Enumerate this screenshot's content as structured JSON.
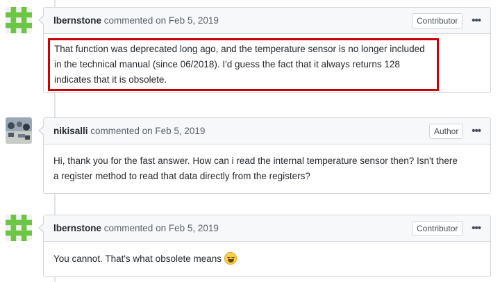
{
  "comments": [
    {
      "author": "lbernstone",
      "meta": "commented on Feb 5, 2019",
      "badge": "Contributor",
      "more": "•••",
      "body": "That function was deprecated long ago, and the temperature sensor is no longer included in the technical manual (since 06/2018). I'd guess the fact that it always returns 128 indicates that it is obsolete."
    },
    {
      "author": "nikisalli",
      "meta": "commented on Feb 5, 2019",
      "badge": "Author",
      "more": "•••",
      "body": "Hi, thank you for the fast answer. How can i read the internal temperature sensor then? Isn't there a register method to read that data directly from the registers?"
    },
    {
      "author": "lbernstone",
      "meta": "commented on Feb 5, 2019",
      "badge": "Contributor",
      "more": "•••",
      "body": "You cannot. That's what obsolete means"
    }
  ],
  "colors": {
    "highlight_border": "#cc0000",
    "identicon": "#6cc644",
    "header_bg": "#f6f8fa"
  },
  "icons": [
    "identicon-avatar",
    "photo-avatar",
    "kebab-menu-icon",
    "grinning-emoji-icon"
  ]
}
